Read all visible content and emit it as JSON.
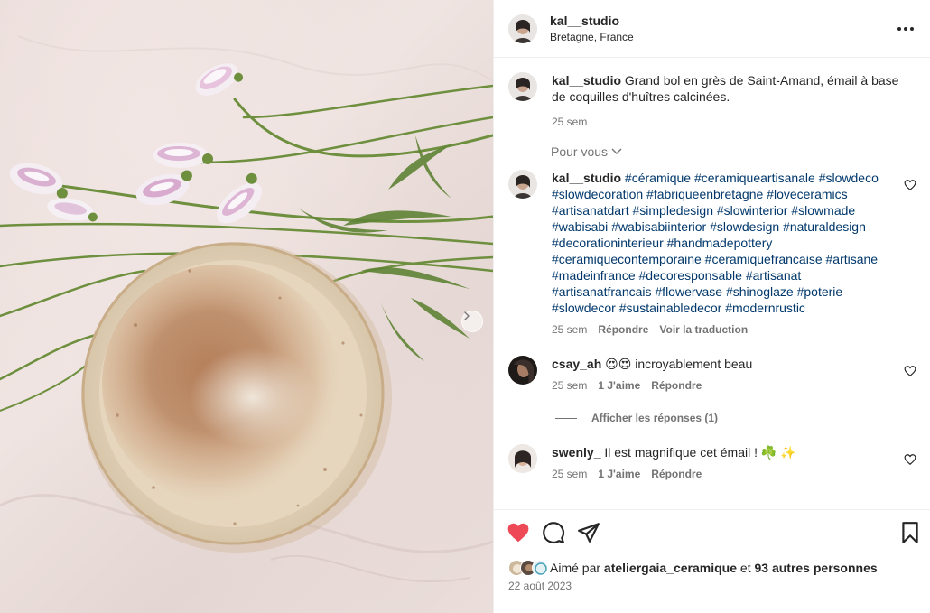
{
  "post": {
    "username": "kal__studio",
    "location": "Bretagne, France",
    "more_label": "more-options"
  },
  "caption": {
    "username": "kal__studio",
    "text": "Grand bol en grès de Saint-Amand, émail à base de coquilles d'huîtres calcinées.",
    "time": "25 sem"
  },
  "pour_vous": "Pour vous",
  "comments": [
    {
      "username": "kal__studio",
      "text": "#céramique #ceramiqueartisanale #slowdeco #slowdecoration #fabriqueenbretagne #loveceramics #artisanatdart #simpledesign #slowinterior #slowmade #wabisabi #wabisabiinterior #slowdesign #naturaldesign #decorationinterieur #handmadepottery #ceramiquecontemporaine #ceramiquefrancaise #artisane #madeinfrance #decoresponsable #artisanat #artisanatfrancais #flowervase #shinoglaze #poterie #slowdecor #sustainabledecor #modernrustic",
      "time": "25 sem",
      "reply": "Répondre",
      "translate": "Voir la traduction"
    },
    {
      "username": "csay_ah",
      "emoji": "😍😍",
      "text": "incroyablement beau",
      "time": "25 sem",
      "likes": "1 J'aime",
      "reply": "Répondre"
    },
    {
      "username": "swenly_",
      "text": "Il est magnifique cet émail ! ☘️ ✨",
      "time": "25 sem",
      "likes": "1 J'aime",
      "reply": "Répondre"
    }
  ],
  "show_replies": "Afficher les réponses (1)",
  "liked_by": {
    "prefix": "Aimé par",
    "user": "ateliergaia_ceramique",
    "middle": "et",
    "others": "93 autres personnes"
  },
  "date": "22 août 2023",
  "colors": {
    "like_red": "#ed4956",
    "link_blue": "#00376b",
    "muted": "#737373"
  }
}
